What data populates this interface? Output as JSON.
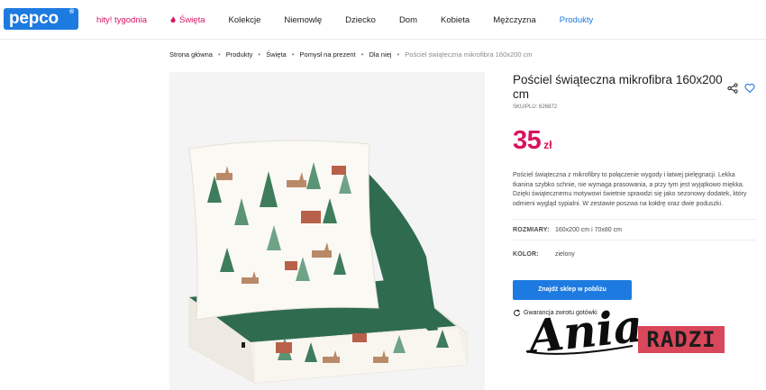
{
  "header": {
    "logo_text": "pepco",
    "logo_mark": "®",
    "nav": [
      {
        "label": "hity! tygodnia",
        "style": "hot"
      },
      {
        "label": "Święta",
        "style": "hot",
        "icon": "flame-icon"
      },
      {
        "label": "Kolekcje",
        "style": "normal"
      },
      {
        "label": "Niemowlę",
        "style": "normal"
      },
      {
        "label": "Dziecko",
        "style": "normal"
      },
      {
        "label": "Dom",
        "style": "normal"
      },
      {
        "label": "Kobieta",
        "style": "normal"
      },
      {
        "label": "Mężczyzna",
        "style": "normal"
      },
      {
        "label": "Produkty",
        "style": "products"
      }
    ]
  },
  "breadcrumb": [
    "Strona główna",
    "Produkty",
    "Święta",
    "Pomysł na prezent",
    "Dla niej",
    "Pościel świąteczna mikrofibra 160x200 cm"
  ],
  "product": {
    "title": "Pościel świąteczna mikrofibra 160x200 cm",
    "sku": "SKU/PLU: 626872",
    "price_value": "35",
    "price_currency": "zł",
    "description": "Pościel świąteczna z mikrofibry to połączenie wygody i łatwej pielęgnacji. Lekka tkanina szybko schnie, nie wymaga prasowania, a przy tym jest wyjątkowo miękka. Dzięki świątecznemu motywowi świetnie sprawdzi się jako sezonowy dodatek, który odmieni wygląd sypialni. W zestawie poszwa na kołdrę oraz dwie poduszki.",
    "attributes": [
      {
        "label": "ROZMIARY:",
        "value": "160x200 cm i 70x80 cm"
      },
      {
        "label": "KOLOR:",
        "value": "zielony"
      }
    ],
    "cta_label": "Znajdź sklep w pobliżu",
    "guarantee_label": "Gwarancja zwrotu gotówki"
  },
  "watermark": {
    "script_text": "Ania",
    "badge_text": "RADZI"
  },
  "colors": {
    "brand_blue": "#1d7ae0",
    "price_magenta": "#d6145f",
    "bedding_green": "#2f6b4f",
    "watermark_red": "#d9475a"
  }
}
